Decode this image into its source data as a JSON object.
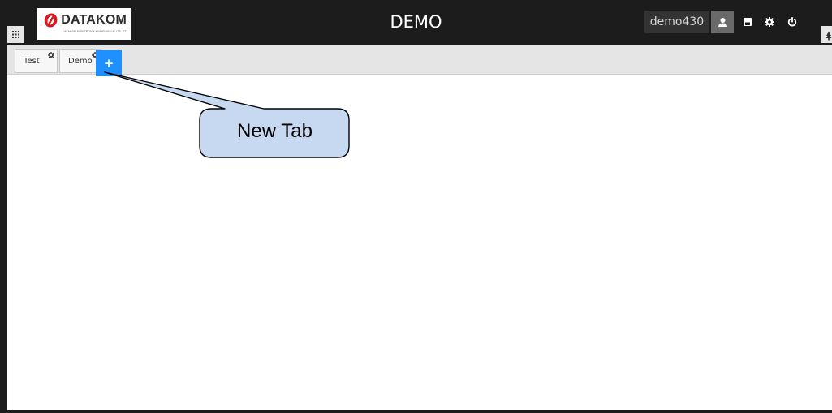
{
  "header": {
    "title": "DEMO",
    "logo_text": "DATAKOM",
    "logo_subtext": "DATAKOM ELEKTRONIK MÜHENDISLIK LTD. STI.",
    "username": "demo430",
    "icons": [
      "user-icon",
      "save-icon",
      "gear-icon",
      "power-icon"
    ]
  },
  "tabs": [
    {
      "label": "Test"
    },
    {
      "label": "Demo"
    }
  ],
  "new_tab": {
    "label": "+"
  },
  "callout": {
    "text": "New Tab"
  },
  "colors": {
    "header_bg": "#1c1c1c",
    "accent": "#1e90ff",
    "callout_fill": "#c6d9f1",
    "logo_red": "#d71920"
  }
}
